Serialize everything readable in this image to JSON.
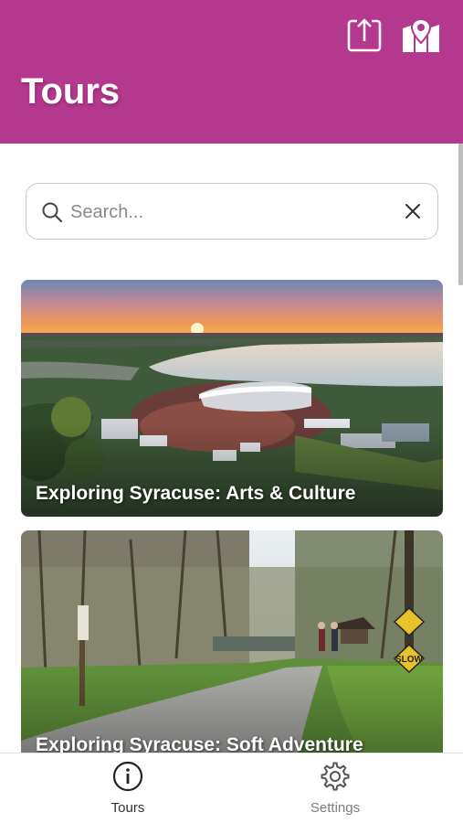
{
  "header": {
    "title": "Tours",
    "share_icon": "share-upload-icon",
    "map_icon": "map-pin-icon",
    "background_color": "#b5388f"
  },
  "search": {
    "placeholder": "Search...",
    "value": "",
    "search_icon": "search-icon",
    "clear_icon": "close-icon"
  },
  "tours": [
    {
      "title": "Exploring Syracuse: Arts & Culture",
      "image": "aerial-amphitheater-lake-sunset"
    },
    {
      "title": "Exploring Syracuse: Soft Adventure",
      "image": "paved-trail-trees-slow-sign"
    }
  ],
  "bottom_nav": {
    "items": [
      {
        "label": "Tours",
        "icon": "info-circle-icon",
        "active": true
      },
      {
        "label": "Settings",
        "icon": "gear-icon",
        "active": false
      }
    ]
  }
}
